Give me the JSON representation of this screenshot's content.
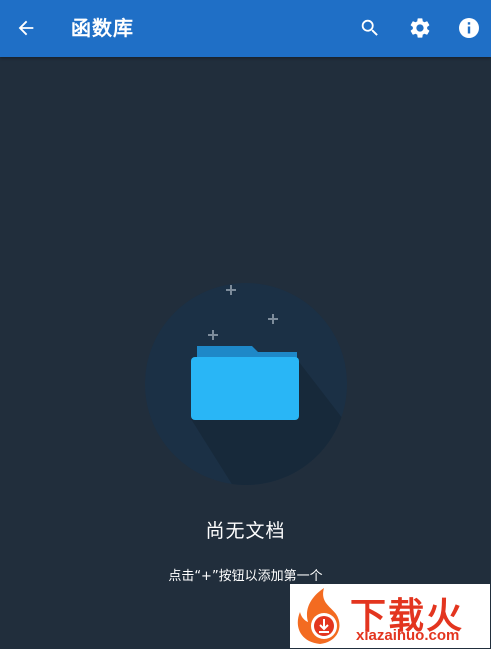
{
  "appbar": {
    "title": "函数库",
    "back_icon": "arrow-back-icon",
    "actions": [
      {
        "icon": "search-icon"
      },
      {
        "icon": "gear-icon"
      },
      {
        "icon": "info-icon"
      }
    ],
    "color": "#1f6fc6"
  },
  "empty_state": {
    "title": "尚无文档",
    "hint": "点击“+”按钮以添加第一个",
    "icon": "folder-icon",
    "folder_color": "#29b6f6"
  },
  "watermark": {
    "text": "下载火",
    "url": "xiazaihuo.com",
    "color": "#e3351f"
  },
  "background": "#212e3c"
}
